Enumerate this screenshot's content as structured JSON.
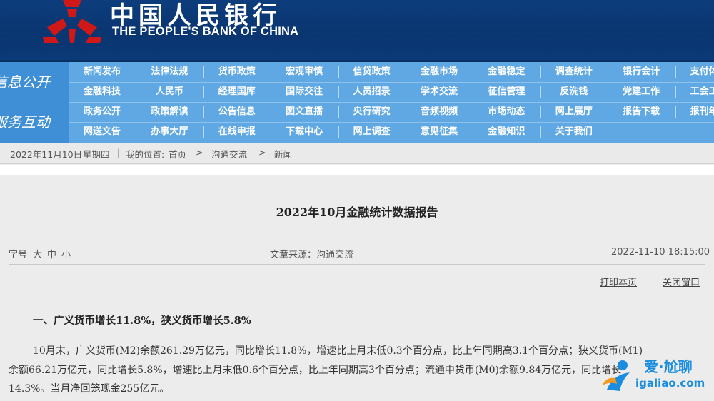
{
  "header": {
    "title_cn": "中国人民银行",
    "title_en": "THE PEOPLE'S BANK OF CHINA",
    "logo_icon": "pboc-emblem-icon",
    "colors": {
      "header_bg": "#0d3d7c",
      "nav_bg": "#5fa8e3",
      "nav_left_bg": "#3e8fd6",
      "logo_red": "#d01818"
    }
  },
  "nav": {
    "section1": "信息公开",
    "section2": "服务互动",
    "rows": [
      [
        "新闻发布",
        "法律法规",
        "货币政策",
        "宏观审慎",
        "信贷政策",
        "金融市场",
        "金融稳定",
        "调查统计",
        "银行会计",
        "支付体系"
      ],
      [
        "金融科技",
        "人民币",
        "经理国库",
        "国际交往",
        "人员招录",
        "学术交流",
        "征信管理",
        "反洗钱",
        "党建工作",
        "工会工作"
      ],
      [
        "政务公开",
        "政策解读",
        "公告信息",
        "图文直播",
        "央行研究",
        "音频视频",
        "市场动态",
        "网上展厅",
        "报告下载",
        "报刊年鉴"
      ],
      [
        "网送文告",
        "办事大厅",
        "在线申报",
        "下载中心",
        "网上调查",
        "意见征集",
        "金融知识",
        "关于我们"
      ]
    ]
  },
  "breadcrumb": {
    "date": "2022年11月10日",
    "weekday": "星期四",
    "sep": "|",
    "location_label": "我的位置:",
    "home": "首页",
    "arrow": ">",
    "level1": "沟通交流",
    "level2": "新闻"
  },
  "article": {
    "title": "2022年10月金融统计数据报告",
    "font_size_label": "字号",
    "font_large": "大",
    "font_medium": "中",
    "font_small": "小",
    "source": "文章来源：沟通交流",
    "datetime": "2022-11-10 18:15:00",
    "print_link": "打印本页",
    "close_link": "关闭窗口",
    "section1_heading": "一、广义货币增长11.8%，狭义货币增长5.8%",
    "para1": [
      "10月末，广义货币(M2)余额261.29万亿元，同比增长11.8%，增速比上月末低0.3个百分点，比上年同期高3.1个百分点；狭义货币(M1)",
      "余额66.21万亿元，同比增长5.8%，增速比上月末低0.6个百分点，比上年同期高3个百分点；流通中货币(M0)余额9.84万亿元，同比增长",
      "14.3%。当月净回笼现金255亿元。"
    ]
  },
  "watermark": {
    "brand": "爱·尬聊",
    "url": "igaliao.com"
  }
}
